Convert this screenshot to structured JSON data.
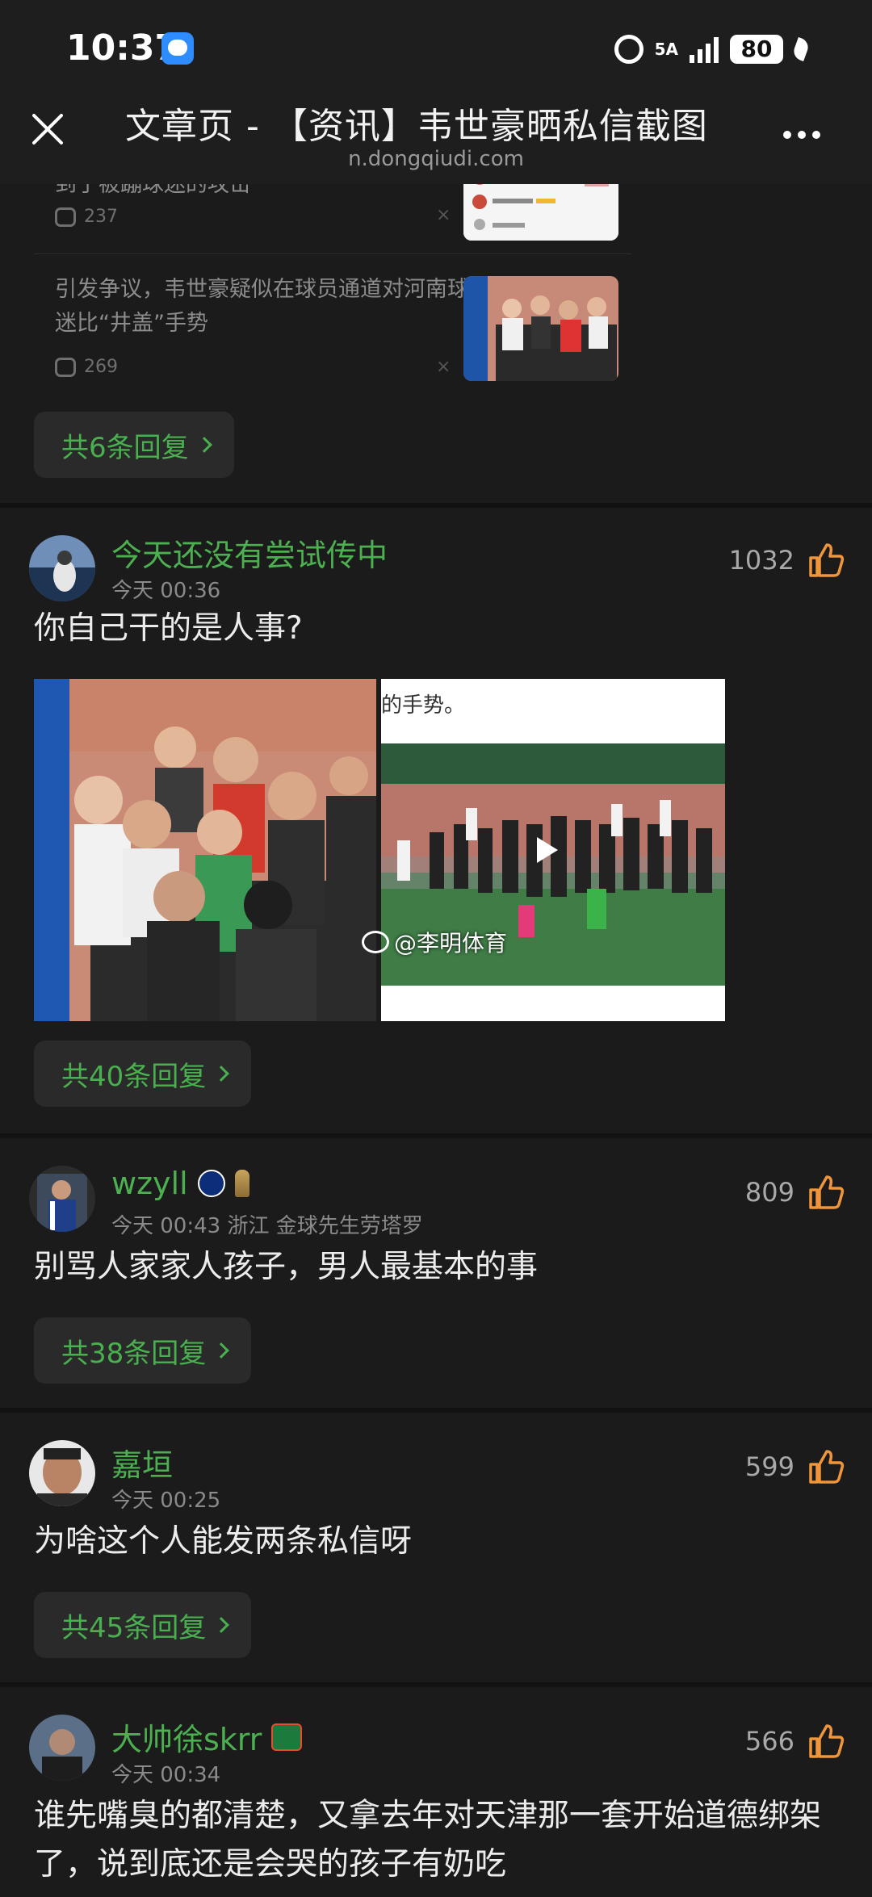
{
  "status_bar": {
    "time": "10:37",
    "network": "5A",
    "battery": "80"
  },
  "nav": {
    "title": "文章页 - 【资讯】韦世豪晒私信截图",
    "url": "n.dongqiudi.com"
  },
  "quoted": {
    "items": [
      {
        "text": "到了被蹦球迷的攻击",
        "comments": "237"
      },
      {
        "text": "引发争议，韦世豪疑似在球员通道对河南球迷比“井盖”手势",
        "comments": "269"
      }
    ],
    "reply_label": "共6条回复"
  },
  "comments": [
    {
      "name": "今天还没有尝试传中",
      "meta": "今天 00:36",
      "likes": "1032",
      "body": "你自己干的是人事?",
      "image_caption": "的手势。",
      "watermark": "@李明体育",
      "reply_label": "共40条回复"
    },
    {
      "name": "wzyll",
      "meta": "今天 00:43 浙江 金球先生劳塔罗",
      "likes": "809",
      "body": "别骂人家家人孩子，男人最基本的事",
      "reply_label": "共38条回复"
    },
    {
      "name": "嘉垣",
      "meta": "今天 00:25",
      "likes": "599",
      "body": "为啥这个人能发两条私信呀",
      "reply_label": "共45条回复"
    },
    {
      "name": "大帅徐skrr",
      "meta": "今天 00:34",
      "likes": "566",
      "body": "谁先嘴臭的都清楚，又拿去年对天津那一套开始道德绑架了，说到底还是会哭的孩子有奶吃"
    }
  ]
}
